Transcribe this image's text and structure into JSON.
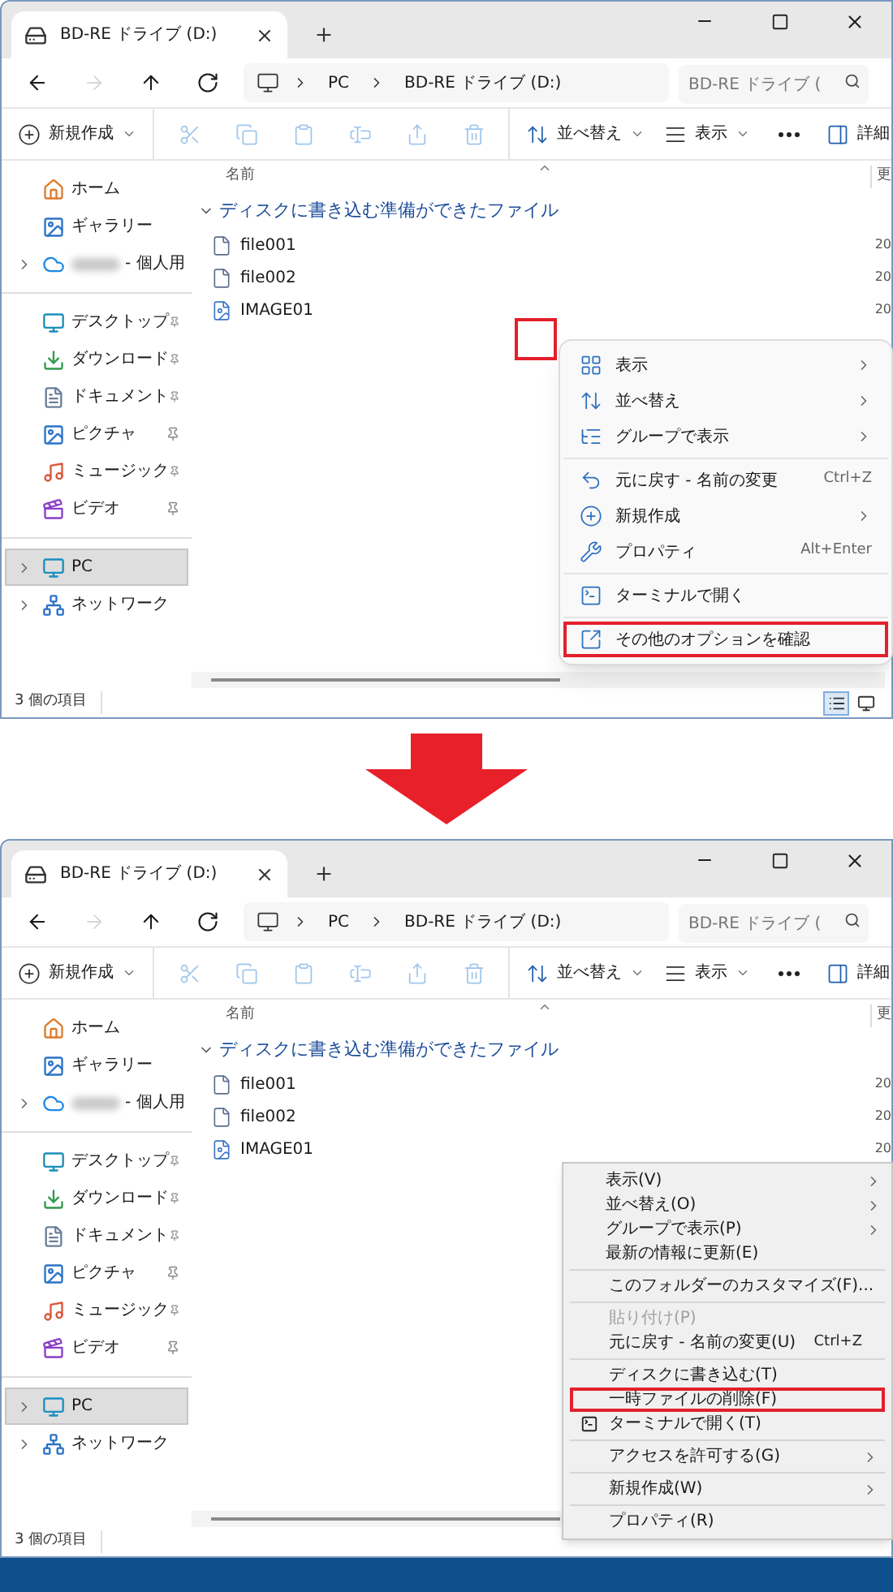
{
  "windows": [
    {
      "tab": {
        "title": "BD-RE ドライブ (D:)"
      },
      "nav_buttons": [
        {
          "disabled": false
        },
        {
          "disabled": true
        },
        {
          "disabled": false
        },
        {
          "disabled": false
        }
      ],
      "address": {
        "crumbs": [
          "PC",
          "BD-RE ドライブ (D:)"
        ]
      },
      "search": {
        "placeholder": "BD-RE ドライブ ("
      },
      "toolbar": {
        "groups": [
          [
            {
              "label": "新規作成",
              "caret": true,
              "disabled": false
            }
          ],
          [
            {
              "caret": false,
              "disabled": true
            },
            {
              "caret": false,
              "disabled": true
            },
            {
              "caret": false,
              "disabled": true
            },
            {
              "caret": false,
              "disabled": true
            },
            {
              "caret": false,
              "disabled": true
            },
            {
              "caret": false,
              "disabled": true
            }
          ],
          [
            {
              "label": "並べ替え",
              "caret": true,
              "disabled": false
            },
            {
              "label": "表示",
              "caret": true,
              "disabled": false
            },
            {
              "caret": false,
              "disabled": false
            }
          ],
          [
            {
              "label": "詳細",
              "caret": false,
              "disabled": false
            }
          ]
        ]
      },
      "sidebar": {
        "groups": [
          [
            {
              "label": "ホーム",
              "has_children": false,
              "pinned": false,
              "selected": false,
              "blurred_prefix": false
            },
            {
              "label": "ギャラリー",
              "has_children": false,
              "pinned": false,
              "selected": false,
              "blurred_prefix": false
            },
            {
              "label": "- 個人用",
              "has_children": true,
              "pinned": false,
              "selected": false,
              "blurred_prefix": true
            }
          ],
          [
            {
              "label": "デスクトップ",
              "has_children": false,
              "pinned": true,
              "selected": false,
              "blurred_prefix": false
            },
            {
              "label": "ダウンロード",
              "has_children": false,
              "pinned": true,
              "selected": false,
              "blurred_prefix": false
            },
            {
              "label": "ドキュメント",
              "has_children": false,
              "pinned": true,
              "selected": false,
              "blurred_prefix": false
            },
            {
              "label": "ピクチャ",
              "has_children": false,
              "pinned": true,
              "selected": false,
              "blurred_prefix": false
            },
            {
              "label": "ミュージック",
              "has_children": false,
              "pinned": true,
              "selected": false,
              "blurred_prefix": false
            },
            {
              "label": "ビデオ",
              "has_children": false,
              "pinned": true,
              "selected": false,
              "blurred_prefix": false
            }
          ],
          [
            {
              "label": "PC",
              "has_children": true,
              "pinned": false,
              "selected": true,
              "blurred_prefix": false
            },
            {
              "label": "ネットワーク",
              "has_children": true,
              "pinned": false,
              "selected": false,
              "blurred_prefix": false
            }
          ]
        ]
      },
      "columns": [
        {
          "label": "名前"
        },
        {
          "label": "更"
        }
      ],
      "group": {
        "label": "ディスクに書き込む準備ができたファイル",
        "expanded": true
      },
      "files": [
        {
          "name": "file001",
          "column_2": "20"
        },
        {
          "name": "file002",
          "column_2": "20"
        },
        {
          "name": "IMAGE01",
          "column_2": "20"
        }
      ],
      "status_bar": {
        "text": "3 個の項目"
      },
      "view_switch": {
        "options": [
          {
            "selected": true
          },
          {
            "selected": false
          }
        ]
      },
      "click_marker": true,
      "context_menu": {
        "kind": "modern",
        "groups": [
          [
            {
              "label": "表示",
              "submenu": true,
              "highlighted": false,
              "disabled": false,
              "icon": true
            },
            {
              "label": "並べ替え",
              "submenu": true,
              "highlighted": false,
              "disabled": false,
              "icon": true
            },
            {
              "label": "グループで表示",
              "submenu": true,
              "highlighted": false,
              "disabled": false,
              "icon": true
            }
          ],
          [
            {
              "label": "元に戻す - 名前の変更",
              "shortcut": "Ctrl+Z",
              "submenu": false,
              "highlighted": false,
              "disabled": false,
              "icon": true
            },
            {
              "label": "新規作成",
              "submenu": true,
              "highlighted": false,
              "disabled": false,
              "icon": true
            },
            {
              "label": "プロパティ",
              "shortcut": "Alt+Enter",
              "submenu": false,
              "highlighted": false,
              "disabled": false,
              "icon": true
            }
          ],
          [
            {
              "label": "ターミナルで開く",
              "submenu": false,
              "highlighted": false,
              "disabled": false,
              "icon": true
            }
          ],
          [
            {
              "label": "その他のオプションを確認",
              "submenu": false,
              "highlighted": true,
              "disabled": false,
              "icon": true
            }
          ]
        ]
      }
    },
    {
      "tab": {
        "title": "BD-RE ドライブ (D:)"
      },
      "nav_buttons": [
        {
          "disabled": false
        },
        {
          "disabled": true
        },
        {
          "disabled": false
        },
        {
          "disabled": false
        }
      ],
      "address": {
        "crumbs": [
          "PC",
          "BD-RE ドライブ (D:)"
        ]
      },
      "search": {
        "placeholder": "BD-RE ドライブ ("
      },
      "toolbar": {
        "groups": [
          [
            {
              "label": "新規作成",
              "caret": true,
              "disabled": false
            }
          ],
          [
            {
              "caret": false,
              "disabled": true
            },
            {
              "caret": false,
              "disabled": true
            },
            {
              "caret": false,
              "disabled": true
            },
            {
              "caret": false,
              "disabled": true
            },
            {
              "caret": false,
              "disabled": true
            },
            {
              "caret": false,
              "disabled": true
            }
          ],
          [
            {
              "label": "並べ替え",
              "caret": true,
              "disabled": false
            },
            {
              "label": "表示",
              "caret": true,
              "disabled": false
            },
            {
              "caret": false,
              "disabled": false
            }
          ],
          [
            {
              "label": "詳細",
              "caret": false,
              "disabled": false
            }
          ]
        ]
      },
      "sidebar": {
        "groups": [
          [
            {
              "label": "ホーム",
              "has_children": false,
              "pinned": false,
              "selected": false,
              "blurred_prefix": false
            },
            {
              "label": "ギャラリー",
              "has_children": false,
              "pinned": false,
              "selected": false,
              "blurred_prefix": false
            },
            {
              "label": "- 個人用",
              "has_children": true,
              "pinned": false,
              "selected": false,
              "blurred_prefix": true
            }
          ],
          [
            {
              "label": "デスクトップ",
              "has_children": false,
              "pinned": true,
              "selected": false,
              "blurred_prefix": false
            },
            {
              "label": "ダウンロード",
              "has_children": false,
              "pinned": true,
              "selected": false,
              "blurred_prefix": false
            },
            {
              "label": "ドキュメント",
              "has_children": false,
              "pinned": true,
              "selected": false,
              "blurred_prefix": false
            },
            {
              "label": "ピクチャ",
              "has_children": false,
              "pinned": true,
              "selected": false,
              "blurred_prefix": false
            },
            {
              "label": "ミュージック",
              "has_children": false,
              "pinned": true,
              "selected": false,
              "blurred_prefix": false
            },
            {
              "label": "ビデオ",
              "has_children": false,
              "pinned": true,
              "selected": false,
              "blurred_prefix": false
            }
          ],
          [
            {
              "label": "PC",
              "has_children": true,
              "pinned": false,
              "selected": true,
              "blurred_prefix": false
            },
            {
              "label": "ネットワーク",
              "has_children": true,
              "pinned": false,
              "selected": false,
              "blurred_prefix": false
            }
          ]
        ]
      },
      "columns": [
        {
          "label": "名前"
        },
        {
          "label": "更"
        }
      ],
      "group": {
        "label": "ディスクに書き込む準備ができたファイル",
        "expanded": true
      },
      "files": [
        {
          "name": "file001",
          "column_2": "20"
        },
        {
          "name": "file002",
          "column_2": "20"
        },
        {
          "name": "IMAGE01",
          "column_2": "20"
        }
      ],
      "status_bar": {
        "text": "3 個の項目"
      },
      "click_marker": false,
      "context_menu": {
        "kind": "classic",
        "groups": [
          [
            {
              "label": "表示(V)",
              "submenu": true,
              "highlighted": false,
              "disabled": false,
              "icon": false
            },
            {
              "label": "並べ替え(O)",
              "submenu": true,
              "highlighted": false,
              "disabled": false,
              "icon": false
            },
            {
              "label": "グループで表示(P)",
              "submenu": true,
              "highlighted": false,
              "disabled": false,
              "icon": false
            },
            {
              "label": "最新の情報に更新(E)",
              "submenu": false,
              "highlighted": false,
              "disabled": false,
              "icon": false
            }
          ],
          [
            {
              "label": "このフォルダーのカスタマイズ(F)...",
              "submenu": false,
              "highlighted": false,
              "disabled": false,
              "icon": false
            }
          ],
          [
            {
              "label": "貼り付け(P)",
              "submenu": false,
              "highlighted": false,
              "disabled": true,
              "icon": false
            },
            {
              "label": "元に戻す - 名前の変更(U)",
              "shortcut": "Ctrl+Z",
              "submenu": false,
              "highlighted": false,
              "disabled": false,
              "icon": false
            }
          ],
          [
            {
              "label": "ディスクに書き込む(T)",
              "submenu": false,
              "highlighted": false,
              "disabled": false,
              "icon": false
            },
            {
              "label": "一時ファイルの削除(F)",
              "submenu": false,
              "highlighted": true,
              "disabled": false,
              "icon": false
            },
            {
              "label": "ターミナルで開く(T)",
              "submenu": false,
              "highlighted": false,
              "disabled": false,
              "icon": true
            }
          ],
          [
            {
              "label": "アクセスを許可する(G)",
              "submenu": true,
              "highlighted": false,
              "disabled": false,
              "icon": false
            }
          ],
          [
            {
              "label": "新規作成(W)",
              "submenu": true,
              "highlighted": false,
              "disabled": false,
              "icon": false
            }
          ],
          [
            {
              "label": "プロパティ(R)",
              "submenu": false,
              "highlighted": false,
              "disabled": false,
              "icon": false
            }
          ]
        ]
      }
    }
  ]
}
